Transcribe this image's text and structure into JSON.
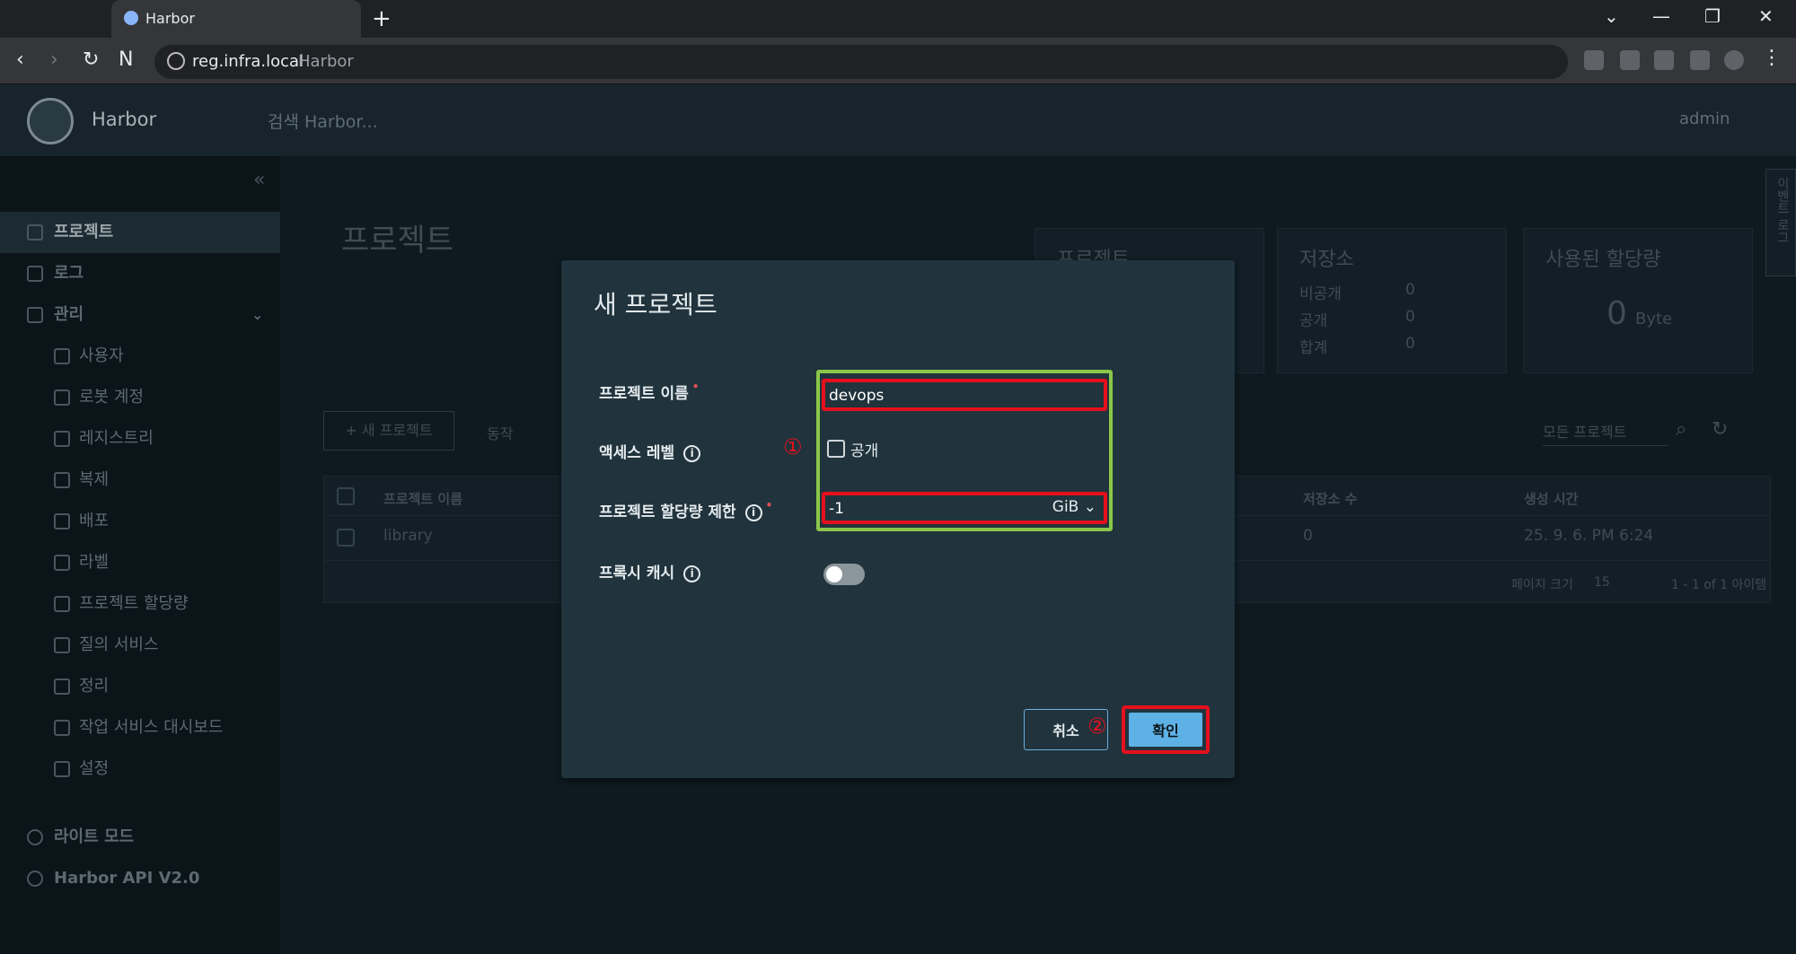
{
  "browser": {
    "tab_title": "Harbor",
    "url_host": "reg.infra.local",
    "url_title": "Harbor"
  },
  "header": {
    "brand": "Harbor",
    "search_placeholder": "검색 Harbor...",
    "user": "admin"
  },
  "sidebar": {
    "items": [
      {
        "label": "프로젝트",
        "icon": "projects-icon"
      },
      {
        "label": "로그",
        "icon": "logs-icon"
      },
      {
        "label": "관리",
        "icon": "admin-icon"
      },
      {
        "label": "사용자",
        "icon": "users-icon"
      },
      {
        "label": "로봇 계정",
        "icon": "robot-icon"
      },
      {
        "label": "레지스트리",
        "icon": "registry-icon"
      },
      {
        "label": "복제",
        "icon": "replication-icon"
      },
      {
        "label": "배포",
        "icon": "distribution-icon"
      },
      {
        "label": "라벨",
        "icon": "label-icon"
      },
      {
        "label": "프로젝트 할당량",
        "icon": "quota-icon"
      },
      {
        "label": "질의 서비스",
        "icon": "interrogation-icon"
      },
      {
        "label": "정리",
        "icon": "cleanup-icon"
      },
      {
        "label": "작업 서비스 대시보드",
        "icon": "dashboard-icon"
      },
      {
        "label": "설정",
        "icon": "settings-icon"
      }
    ],
    "light_mode": "라이트 모드",
    "api": "Harbor API V2.0"
  },
  "main": {
    "title": "프로젝트",
    "cards": {
      "projects_title": "프로젝트",
      "repos_title": "저장소",
      "repos_private_label": "비공개",
      "repos_private_value": "0",
      "repos_public_label": "공개",
      "repos_public_value": "0",
      "repos_total_label": "합계",
      "repos_total_value": "0",
      "quota_title": "사용된 할당량",
      "quota_value": "0",
      "quota_unit": "Byte"
    },
    "new_project_button": "+ 새 프로젝트",
    "action_button": "동작",
    "filter": "모든 프로젝트",
    "table": {
      "columns": [
        "프로젝트 이름",
        "저장소 수",
        "생성 시간"
      ],
      "rows": [
        {
          "name": "library",
          "repo_count": "0",
          "created": "25. 9. 6. PM 6:24"
        }
      ],
      "page_size_label": "페이지 크기",
      "page_size": "15",
      "pagination": "1 - 1 of 1 아이템"
    },
    "side_tab": "이벤트 로그"
  },
  "modal": {
    "title": "새 프로젝트",
    "project_name_label": "프로젝트 이름",
    "project_name_value": "devops",
    "access_level_label": "액세스 레벨",
    "public_label": "공개",
    "quota_label": "프로젝트 할당량 제한",
    "quota_value": "-1",
    "quota_unit": "GiB",
    "proxy_cache_label": "프록시 캐시",
    "cancel_button": "취소",
    "ok_button": "확인",
    "annotation_1": "①",
    "annotation_2": "②"
  },
  "colors": {
    "highlight_green": "#8ac64a",
    "highlight_red": "#e5101d",
    "primary_button": "#5eb1e4"
  }
}
